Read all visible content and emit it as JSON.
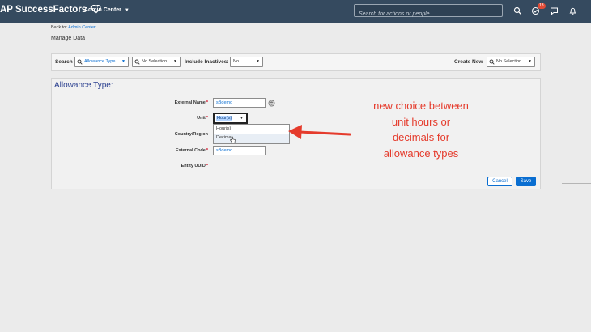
{
  "shell": {
    "brand": "AP SuccessFactors",
    "admin_center": "Admin Center",
    "search_placeholder": "Search for actions or people",
    "notification_count": "13"
  },
  "breadcrumb": {
    "back_prefix": "Back to: ",
    "back_link": "Admin Center"
  },
  "page_title": "Manage Data",
  "search_bar": {
    "search_label": "Search",
    "search_type": "Allowance Type",
    "search_value": "No Selection",
    "include_inactives_label": "Include Inactives:",
    "include_inactives_value": "No",
    "create_new_label": "Create New",
    "create_new_value": "No Selection"
  },
  "form": {
    "title": "Allowance Type:",
    "external_name_label": "External Name",
    "external_name_value": "sBdemo",
    "unit_label": "Unit",
    "unit_value": "Hour(s)",
    "unit_options": [
      "Hour(s)",
      "Decimal"
    ],
    "country_label": "Country/Region",
    "external_code_label": "External Code",
    "external_code_value": "sBdemo",
    "entity_uuid_label": "Entity UUID",
    "cancel_label": "Cancel",
    "save_label": "Save"
  },
  "annotation": "new choice between\nunit hours or\ndecimals for\nallowance types",
  "colors": {
    "shell_bg": "#354a5f",
    "accent": "#0a6ed1",
    "annotation_red": "#e53b2c",
    "required": "#d0021b"
  }
}
